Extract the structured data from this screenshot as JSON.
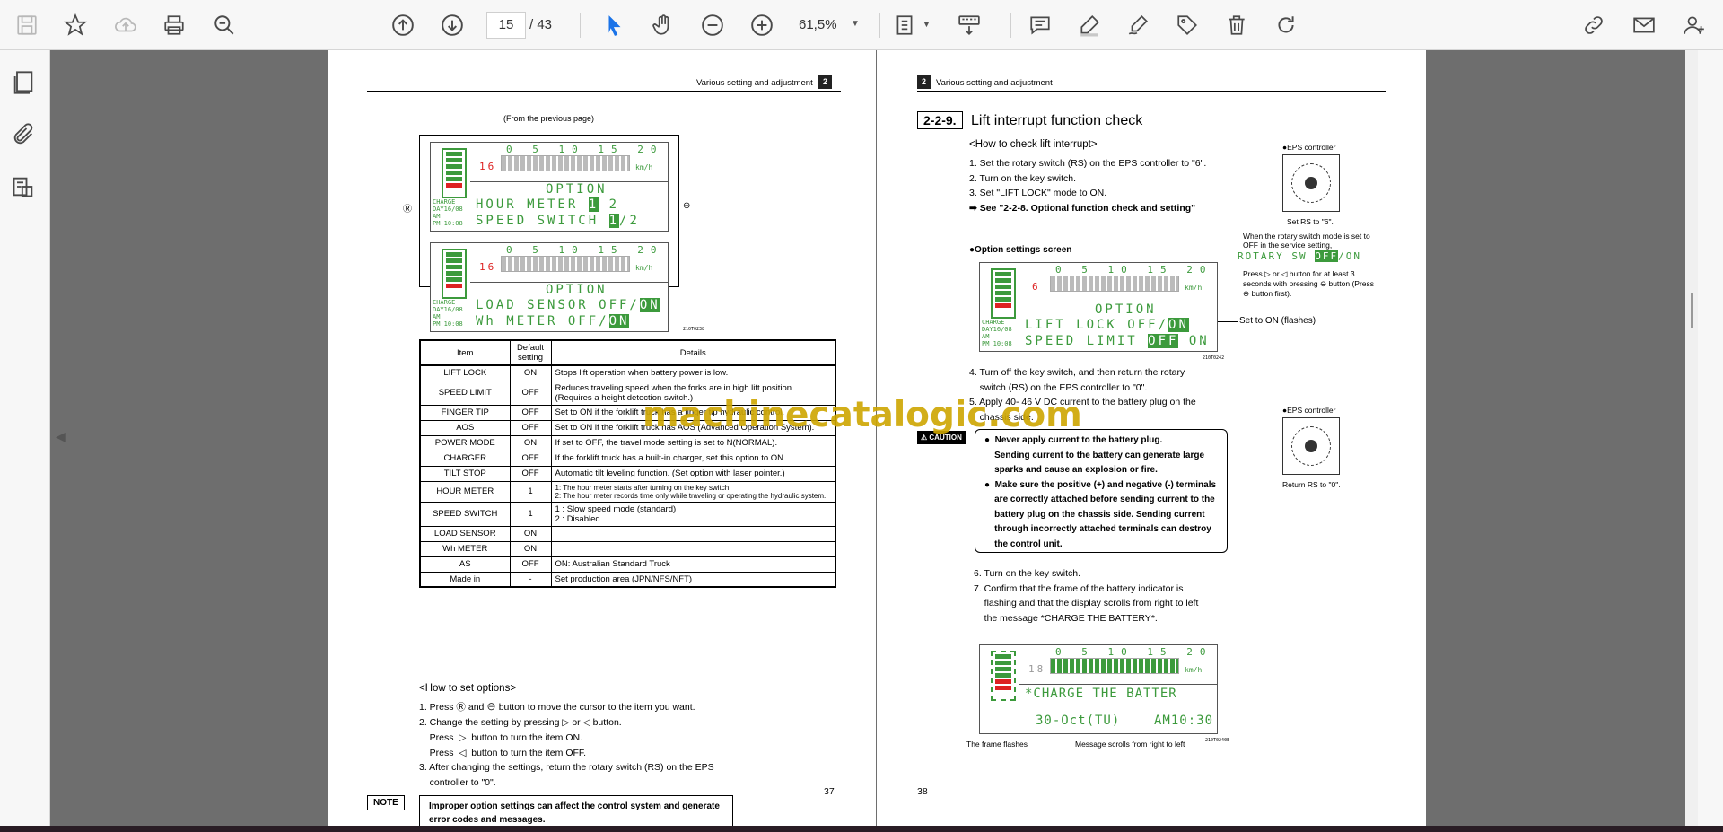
{
  "toolbar": {
    "page_current": "15",
    "page_total": "/  43",
    "zoom": "61,5%"
  },
  "left_page": {
    "header": "Various setting and adjustment",
    "chapter": "2",
    "from_prev": "(From the previous page)",
    "lcd1": {
      "speed_digit": "16",
      "unit": "km/h",
      "scale": "0 5 10 15 20",
      "line1": "OPTION",
      "line2a": "HOUR METER  ",
      "line2b": "1",
      "line2c": " 2",
      "line3a": "SPEED SWITCH  ",
      "line3b": "1",
      "line3c": "/2",
      "side_small": "CHARGE\nDAY16/08\nAM\nPM 10:08"
    },
    "lcd2": {
      "speed_digit": "16",
      "unit": "km/h",
      "scale": "0 5 10 15 20",
      "line1": "OPTION",
      "line2a": "LOAD SENSOR OFF/",
      "line2b": "ON",
      "line3a": "Wh METER    OFF/",
      "line3b": "ON",
      "side_small": "CHARGE\nDAY16/08\nAM\nPM 10:08"
    },
    "fig_code": "210T0238",
    "table": {
      "headers": [
        "Item",
        "Default setting",
        "Details"
      ],
      "rows": [
        [
          "LIFT LOCK",
          "ON",
          "Stops lift operation when battery power is low."
        ],
        [
          "SPEED LIMIT",
          "OFF",
          "Reduces traveling speed when the forks are in high lift position. (Requires a height detection switch.)"
        ],
        [
          "FINGER TIP",
          "OFF",
          "Set to ON if the forklift truck has a finger tip hydraulic control."
        ],
        [
          "AOS",
          "OFF",
          "Set to ON if the forklift truck has AOS (Advanced Operation System)."
        ],
        [
          "POWER MODE",
          "ON",
          "If set to OFF, the travel mode setting is set to N(NORMAL)."
        ],
        [
          "CHARGER",
          "OFF",
          "If the forklift truck has a built-in charger, set this option to ON."
        ],
        [
          "TILT STOP",
          "OFF",
          "Automatic tilt leveling function. (Set option with laser pointer.)"
        ],
        [
          "HOUR METER",
          "1",
          "1: The hour meter starts after turning on the key switch.\n2: The hour meter records time only while traveling or operating the hydraulic system."
        ],
        [
          "SPEED SWITCH",
          "1",
          "1 : Slow speed mode (standard)\n2 : Disabled"
        ],
        [
          "LOAD SENSOR",
          "ON",
          ""
        ],
        [
          "Wh METER",
          "ON",
          ""
        ],
        [
          "AS",
          "OFF",
          "ON: Australian Standard Truck"
        ],
        [
          "Made in",
          "-",
          "Set production area (JPN/NFS/NFT)"
        ]
      ]
    },
    "how_to_title": "<How to set options>",
    "steps": [
      "1. Press  Ⓡ  and  ⊖  button to move the cursor to the item you want.",
      "2. Change the setting by pressing  ▷  or  ◁  button.",
      "    Press  ▷  button to turn the item ON.",
      "    Press  ◁  button to turn the item OFF.",
      "3. After changing the settings, return the rotary switch (RS) on the EPS",
      "    controller to \"0\"."
    ],
    "note_tag": "NOTE",
    "note_text": "Improper option settings can affect the control system and generate error codes and messages.",
    "page_number": "37"
  },
  "right_page": {
    "header": "Various setting and adjustment",
    "chapter": "2",
    "section_num": "2-2-9.",
    "section_title": "Lift interrupt function check",
    "subtitle": "<How to check lift interrupt>",
    "steps_a": [
      "1. Set the rotary switch (RS) on the EPS controller to \"6\".",
      "2. Turn on the key switch.",
      "3. Set \"LIFT LOCK\" mode to ON."
    ],
    "see_ref": "See \"2-2-8. Optional function check and setting\"",
    "eps_label1": "●EPS controller",
    "eps_caption1": "Set RS to \"6\".",
    "service_note": "When the rotary switch mode is set to OFF in the service setting,",
    "rotary_a": "ROTARY SW ",
    "rotary_b": "OFF",
    "rotary_c": "/ON",
    "press_note": "Press ▷ or ◁ button for at least 3 seconds with pressing ⊖ button (Press ⊖ button first).",
    "opt_screen_label": "●Option settings screen",
    "lcd3": {
      "speed_digit": "6",
      "unit": "km/h",
      "scale": "0 5 10 15 20",
      "line1": "OPTION",
      "line2a": "LIFT LOCK   OFF/",
      "line2b": "ON",
      "line3a": "SPEED LIMIT ",
      "line3b": "OFF",
      "line3c": " ON",
      "side_small": "CHARGE\nDAY16/08\nAM\nPM 10:08"
    },
    "flash_note": "Set to ON (flashes)",
    "fig_code2": "210T0242",
    "steps_b": [
      "4. Turn off the key switch, and then return the rotary",
      "    switch (RS) on the EPS controller to \"0\".",
      "5. Apply 40- 46 V DC current to the battery plug on the",
      "    chassis side."
    ],
    "eps_label2": "●EPS controller",
    "eps_caption2": "Return RS to \"0\".",
    "caution_tag": "CAUTION",
    "caution_lines": [
      "●  Never apply current to the battery plug.",
      "    Sending current to the battery can generate large",
      "    sparks and cause an explosion or fire.",
      "●  Make sure the positive (+) and negative (-) terminals",
      "    are correctly attached before sending current to the",
      "    battery plug on the chassis side. Sending current",
      "    through incorrectly attached terminals can destroy",
      "    the control unit."
    ],
    "steps_c": [
      "6. Turn on the key switch.",
      "7. Confirm that the frame of the battery indicator is",
      "    flashing and that the display scrolls from right to left",
      "    the message *CHARGE THE BATTERY*."
    ],
    "lcd4": {
      "speed_digit": "18",
      "unit": "km/h",
      "scale": "0 5 10 15 20",
      "line1": "*CHARGE THE BATTER",
      "line2a": "30-Oct(TU)",
      "line2b": "AM10:30"
    },
    "cap_frame": "The frame flashes",
    "cap_scroll": "Message scrolls from right to left",
    "fig_code3": "210T0240E",
    "page_number": "38"
  },
  "watermark": "machinecatalogic.com"
}
